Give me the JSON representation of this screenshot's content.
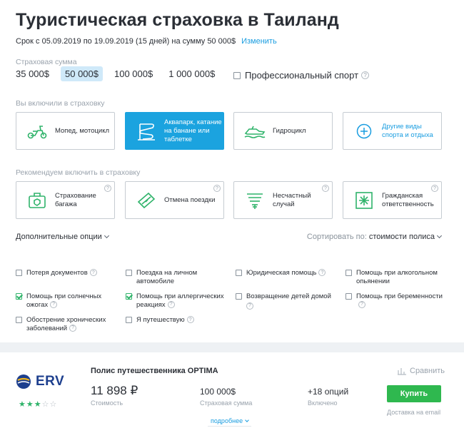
{
  "header": {
    "title": "Туристическая страховка в Таиланд",
    "term_text": "Срок с 05.09.2019 по 19.09.2019 (15 дней) на сумму 50 000$",
    "change_link": "Изменить"
  },
  "insured_sum": {
    "label": "Страховая сумма",
    "options": [
      "35 000$",
      "50 000$",
      "100 000$",
      "1 000 000$"
    ],
    "selected": "50 000$"
  },
  "pro_sport": {
    "label": "Профессиональный спорт",
    "checked": false
  },
  "included": {
    "label": "Вы включили в страховку",
    "cards": [
      {
        "label": "Мопед, мотоцикл",
        "icon": "moped-icon"
      },
      {
        "label": "Аквапарк, катание на банане или таблетке",
        "icon": "waterslide-icon",
        "active": true
      },
      {
        "label": "Гидроцикл",
        "icon": "jetski-icon"
      },
      {
        "label": "Другие виды спорта и отдыха",
        "icon": "plus-circle-icon"
      }
    ]
  },
  "recommended": {
    "label": "Рекомендуем включить в страховку",
    "cards": [
      {
        "label": "Страхование багажа",
        "icon": "luggage-icon"
      },
      {
        "label": "Отмена поездки",
        "icon": "ticket-icon"
      },
      {
        "label": "Несчастный случай",
        "icon": "accident-icon"
      },
      {
        "label": "Гражданская ответственность",
        "icon": "liability-icon"
      }
    ]
  },
  "controls": {
    "additional_options": "Дополнительные опции",
    "sort_prefix": "Сортировать по:",
    "sort_value": "стоимости полиса"
  },
  "options": [
    {
      "label": "Потеря документов",
      "checked": false
    },
    {
      "label": "Поездка на личном автомобиле",
      "checked": false
    },
    {
      "label": "Юридическая помощь",
      "checked": false
    },
    {
      "label": "Помощь при алкогольном опьянении",
      "checked": false
    },
    {
      "label": "Помощь при солнечных ожогах",
      "checked": true
    },
    {
      "label": "Помощь при аллергических реакциях",
      "checked": true
    },
    {
      "label": "Возвращение детей домой",
      "checked": false
    },
    {
      "label": "Помощь при беременности",
      "checked": false
    },
    {
      "label": "Обострение хронических заболеваний",
      "checked": false
    },
    {
      "label": "Я путешествую",
      "checked": false
    }
  ],
  "offer": {
    "insurer": "ERV",
    "rating": 3,
    "rating_max": 5,
    "policy_title": "Полис путешественника OPTIMA",
    "compare": "Сравнить",
    "price": "11 898 ₽",
    "price_label": "Стоимость",
    "sum": "100 000$",
    "sum_label": "Страховая сумма",
    "options": "+18 опций",
    "options_label": "Включено",
    "buy": "Купить",
    "delivery": "Доставка на email",
    "more": "подробнее"
  },
  "colors": {
    "accent": "#1ba3df",
    "link": "#1a9de0",
    "green": "#2fb84f",
    "selected_sum_bg": "#cfe9f9",
    "erv_blue": "#1d3f8e",
    "star": "#2fb36a"
  }
}
